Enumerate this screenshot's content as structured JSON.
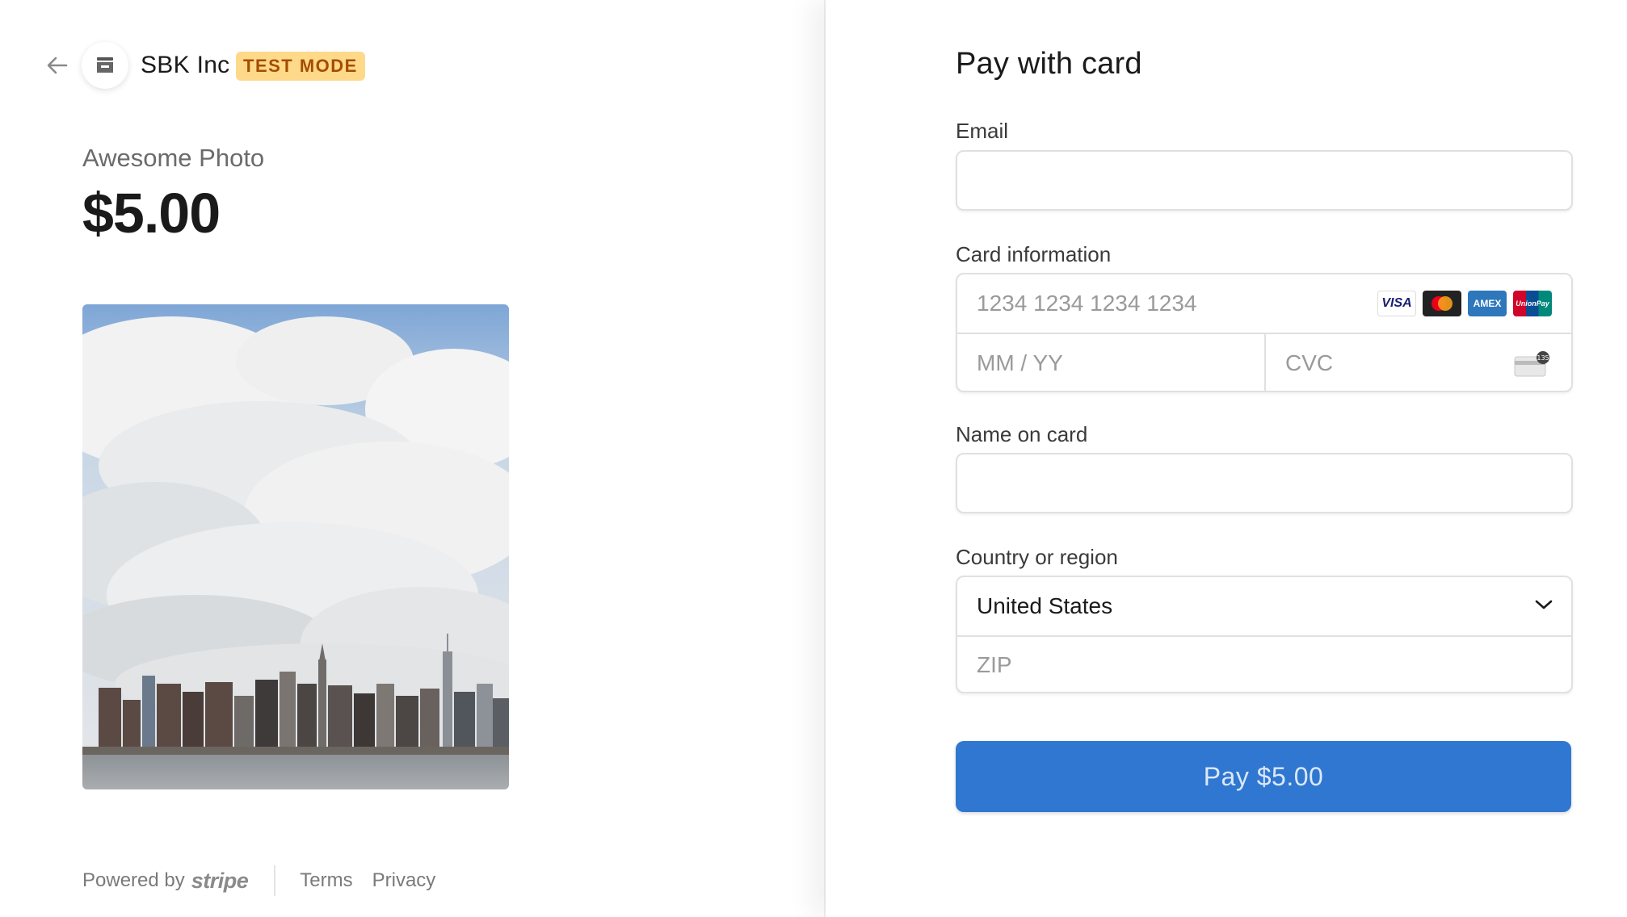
{
  "header": {
    "merchant_name": "SBK Inc",
    "mode_badge": "TEST MODE",
    "back_icon": "arrow-left-icon",
    "logo_icon": "store-icon"
  },
  "product": {
    "name": "Awesome Photo",
    "price": "$5.00",
    "image_alt": "city-skyline-photo"
  },
  "footer": {
    "powered_by": "Powered by",
    "brand": "stripe",
    "terms": "Terms",
    "privacy": "Privacy"
  },
  "form": {
    "title": "Pay with card",
    "email": {
      "label": "Email",
      "value": "",
      "placeholder": ""
    },
    "card": {
      "label": "Card information",
      "number_placeholder": "1234 1234 1234 1234",
      "expiry_placeholder": "MM / YY",
      "cvc_placeholder": "CVC",
      "brands": [
        "VISA",
        "mastercard",
        "AMEX",
        "UnionPay"
      ],
      "cvc_icon": "card-cvc-icon",
      "cvc_hint": "135"
    },
    "name": {
      "label": "Name on card",
      "value": "",
      "placeholder": ""
    },
    "country": {
      "label": "Country or region",
      "selected": "United States",
      "zip_placeholder": "ZIP"
    },
    "pay_button": "Pay $5.00"
  },
  "colors": {
    "badge_bg": "#ffd98a",
    "badge_text": "#a44d00",
    "pay_button_bg": "#2f77d1",
    "visa_blue": "#1a1f71",
    "amex_blue": "#2e77bc",
    "unionpay_red": "#d10429"
  }
}
